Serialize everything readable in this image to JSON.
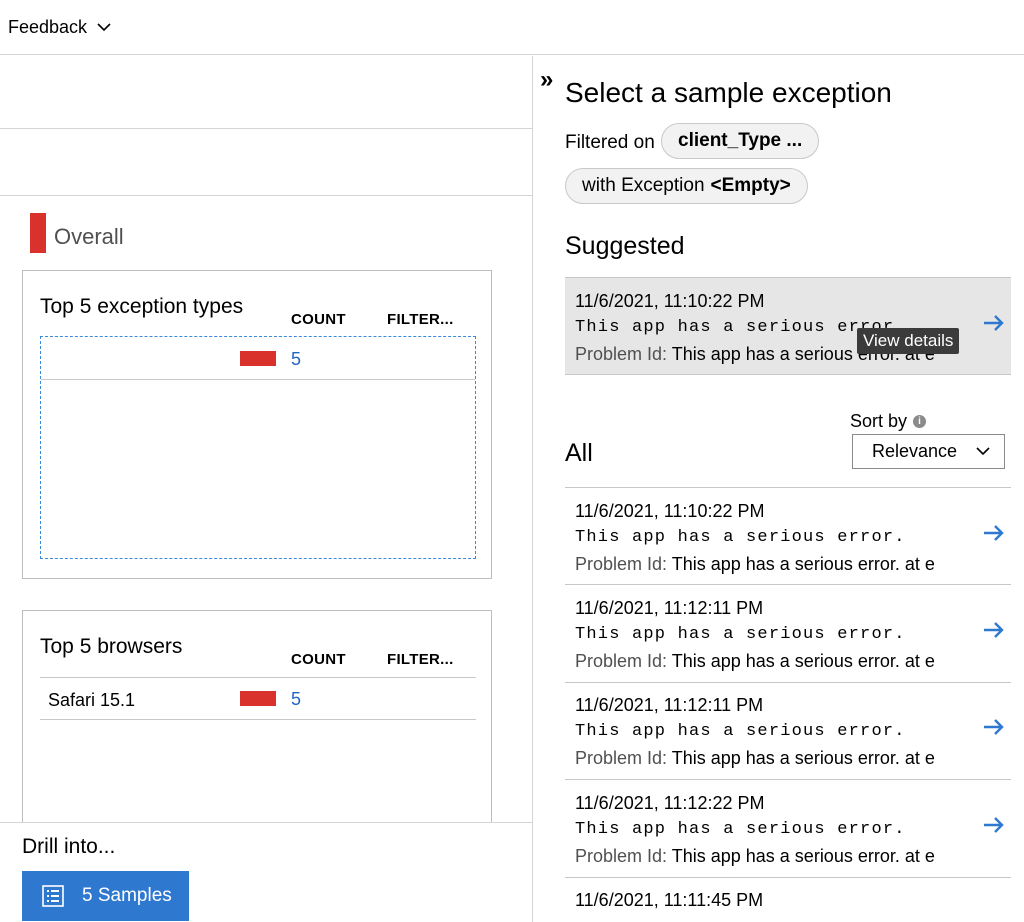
{
  "topbar": {
    "feedback_label": "Feedback"
  },
  "left": {
    "overall_label": "Overall",
    "cards": [
      {
        "title": "Top 5 exception types",
        "col_count": "COUNT",
        "col_filter": "FILTER...",
        "rows": [
          {
            "label": "",
            "count": "5"
          }
        ]
      },
      {
        "title": "Top 5 browsers",
        "col_count": "COUNT",
        "col_filter": "FILTER...",
        "rows": [
          {
            "label": "Safari 15.1",
            "count": "5"
          }
        ]
      }
    ],
    "drill_label": "Drill into...",
    "samples_button": "5 Samples"
  },
  "right": {
    "title": "Select a sample exception",
    "filtered_on": "Filtered on",
    "filter_pill_1": "client_Type ...",
    "filter_pill_2_prefix": "with Exception",
    "filter_pill_2_value": "<Empty>",
    "suggested_label": "Suggested",
    "suggested": {
      "date": "11/6/2021, 11:10:22 PM",
      "message": "This app has a serious error.",
      "problem_key": "Problem Id:",
      "problem_value": "This app has a serious error. at e"
    },
    "tooltip": "View details",
    "sort_by": "Sort by",
    "sort_value": "Relevance",
    "all_label": "All",
    "samples": [
      {
        "date": "11/6/2021, 11:10:22 PM",
        "message": "This app has a serious error.",
        "problem_key": "Problem Id:",
        "problem_value": "This app has a serious error. at e"
      },
      {
        "date": "11/6/2021, 11:12:11 PM",
        "message": "This app has a serious error.",
        "problem_key": "Problem Id:",
        "problem_value": "This app has a serious error. at e"
      },
      {
        "date": "11/6/2021, 11:12:11 PM",
        "message": "This app has a serious error.",
        "problem_key": "Problem Id:",
        "problem_value": "This app has a serious error. at e"
      },
      {
        "date": "11/6/2021, 11:12:22 PM",
        "message": "This app has a serious error.",
        "problem_key": "Problem Id:",
        "problem_value": "This app has a serious error. at e"
      },
      {
        "date": "11/6/2021, 11:11:45 PM",
        "message": "",
        "problem_key": "",
        "problem_value": ""
      }
    ]
  },
  "colors": {
    "accent": "#2f78d0",
    "bar": "#d9312b",
    "link": "#2266c2"
  },
  "icons": [
    "chevron-down-icon",
    "double-chevron-right-icon",
    "arrow-right-icon",
    "info-icon",
    "list-icon"
  ]
}
